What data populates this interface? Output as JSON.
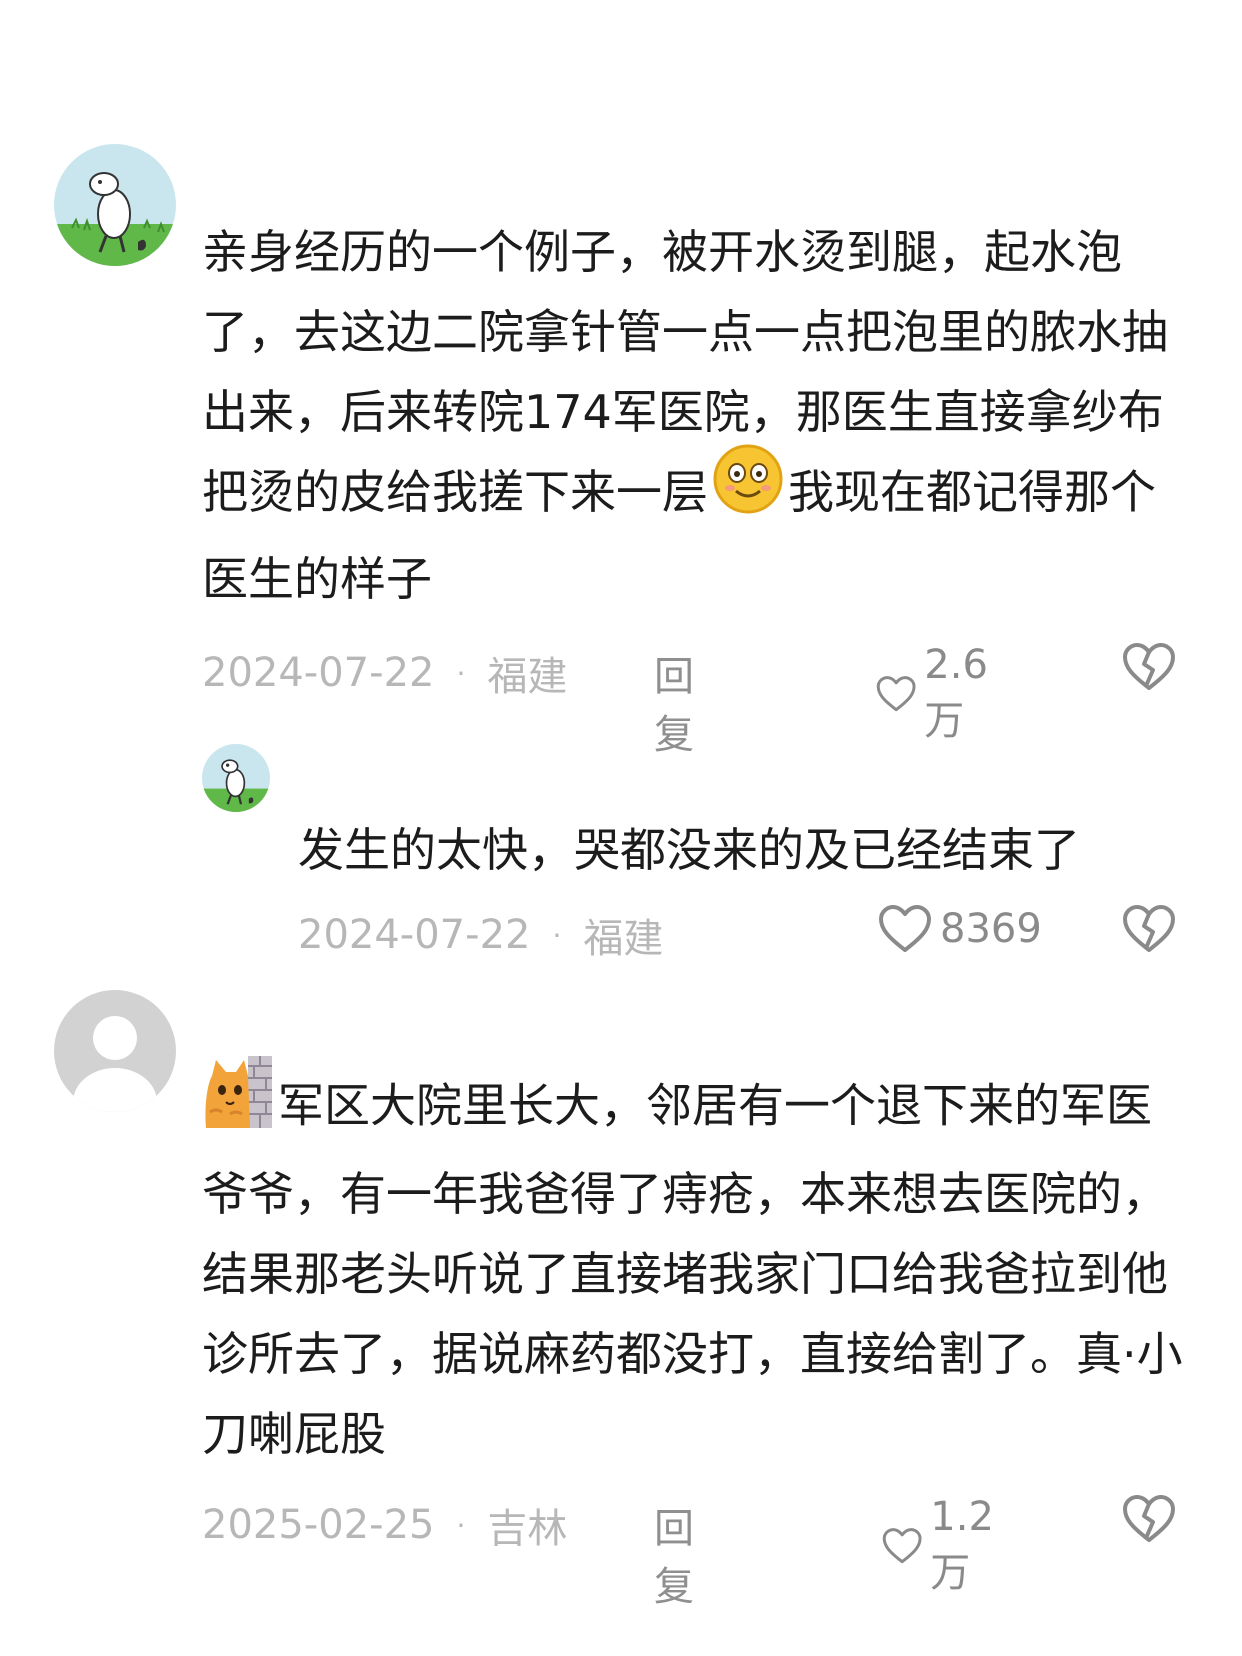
{
  "comments": [
    {
      "avatar": "dog-avatar-icon",
      "text_part1": "亲身经历的一个例子，被开水烫到腿，起水泡了，去这边二院拿针管一点一点把泡里的脓水抽出来，后来转院174军医院，那医生直接拿纱布把烫的皮给我搓下来一层",
      "emoji": "smile-emoji-icon",
      "text_part2": "我现在都记得那个医生的样子",
      "date": "2024-07-22",
      "location": "福建",
      "reply_label": "回复",
      "likes": "2.6万"
    },
    {
      "avatar": "dog-avatar-icon",
      "text": "发生的太快，哭都没来的及已经结束了",
      "date": "2024-07-22",
      "location": "福建",
      "likes": "8369"
    },
    {
      "avatar": "default-user-avatar-icon",
      "emoji": "cat-peek-emoji-icon",
      "text": "军区大院里长大，邻居有一个退下来的军医爷爷，有一年我爸得了痔疮，本来想去医院的，结果那老头听说了直接堵我家门口给我爸拉到他诊所去了，据说麻药都没打，直接给割了。真·小刀喇屁股",
      "date": "2025-02-25",
      "location": "吉林",
      "reply_label": "回复",
      "likes": "1.2万"
    }
  ],
  "separator": "·",
  "colors": {
    "meta": "#b7b7b7",
    "text": "#1c1c1c",
    "icon": "#8a8a8a"
  }
}
